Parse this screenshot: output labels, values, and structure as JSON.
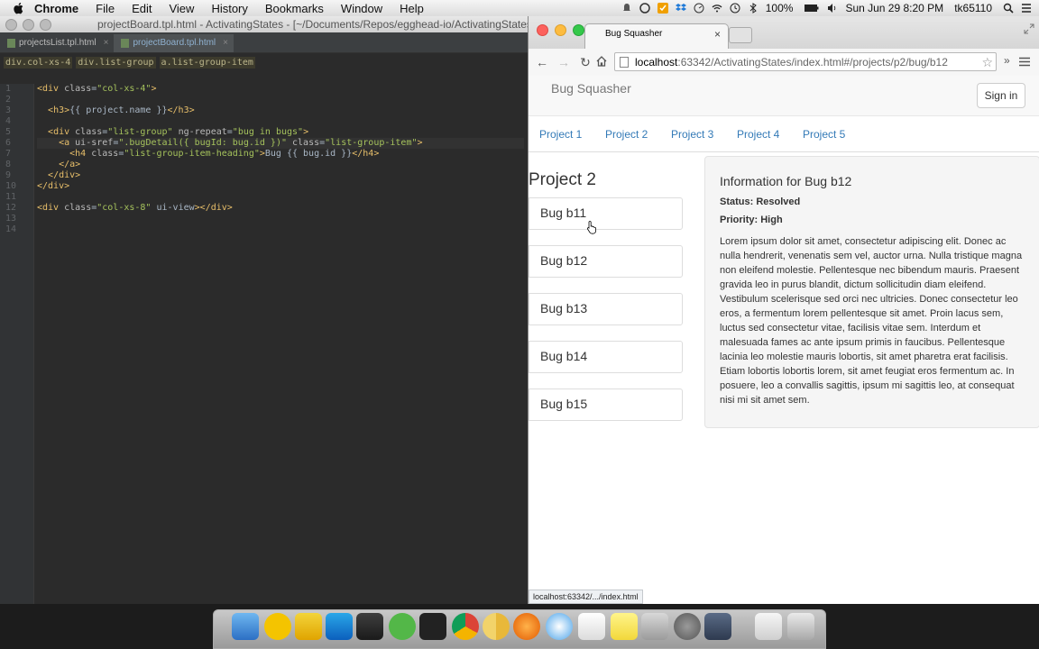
{
  "menubar": {
    "app": "Chrome",
    "items": [
      "File",
      "Edit",
      "View",
      "History",
      "Bookmarks",
      "Window",
      "Help"
    ],
    "battery": "100%",
    "clock": "Sun Jun 29  8:20 PM",
    "user": "tk65110"
  },
  "ide": {
    "window_title": "projectBoard.tpl.html - ActivatingStates - [~/Documents/Repos/egghead-io/ActivatingStates",
    "tabs": [
      {
        "label": "projectsList.tpl.html",
        "active": false
      },
      {
        "label": "projectBoard.tpl.html",
        "active": true
      }
    ],
    "breadcrumbs": [
      "div.col-xs-4",
      "div.list-group",
      "a.list-group-item"
    ],
    "line_numbers": [
      "1",
      "2",
      "3",
      "4",
      "5",
      "6",
      "7",
      "8",
      "9",
      "10",
      "11",
      "12",
      "13",
      "14"
    ],
    "code": [
      "<div class=\"col-xs-4\">",
      "",
      "  <h3>{{ project.name }}</h3>",
      "",
      "  <div class=\"list-group\" ng-repeat=\"bug in bugs\">",
      "    <a ui-sref=\".bugDetail({ bugId: bug.id })\" class=\"list-group-item\">",
      "      <h4 class=\"list-group-item-heading\">Bug {{ bug.id }}</h4>",
      "    </a>",
      "  </div>",
      "</div>",
      "",
      "<div class=\"col-xs-8\" ui-view></div>",
      "",
      ""
    ]
  },
  "browser": {
    "tab_title": "Bug Squasher",
    "url_host": "localhost",
    "url_path": ":63342/ActivatingStates/index.html#/projects/p2/bug/b12",
    "status_url": "localhost:63342/.../index.html"
  },
  "app": {
    "brand": "Bug Squasher",
    "sign_in": "Sign in",
    "projects": [
      "Project 1",
      "Project 2",
      "Project 3",
      "Project 4",
      "Project 5"
    ],
    "project_title": "Project 2",
    "bugs": [
      "Bug b11",
      "Bug b12",
      "Bug b13",
      "Bug b14",
      "Bug b15"
    ],
    "detail": {
      "title": "Information for Bug b12",
      "status": "Status: Resolved",
      "priority": "Priority: High",
      "body": "Lorem ipsum dolor sit amet, consectetur adipiscing elit. Donec ac nulla hendrerit, venenatis sem vel, auctor urna. Nulla tristique magna non eleifend molestie. Pellentesque nec bibendum mauris. Praesent gravida leo in purus blandit, dictum sollicitudin diam eleifend. Vestibulum scelerisque sed orci nec ultricies. Donec consectetur leo eros, a fermentum lorem pellentesque sit amet. Proin lacus sem, luctus sed consectetur vitae, facilisis vitae sem. Interdum et malesuada fames ac ante ipsum primis in faucibus. Pellentesque lacinia leo molestie mauris lobortis, sit amet pharetra erat facilisis. Etiam lobortis lobortis lorem, sit amet feugiat eros fermentum ac. In posuere, leo a convallis sagittis, ipsum mi sagittis leo, at consequat nisi mi sit amet sem."
    }
  },
  "colors": {
    "link": "#337ab7",
    "ide_bg": "#2b2b2b",
    "tag": "#e8bf6a",
    "attr_value": "#a5c25c"
  }
}
